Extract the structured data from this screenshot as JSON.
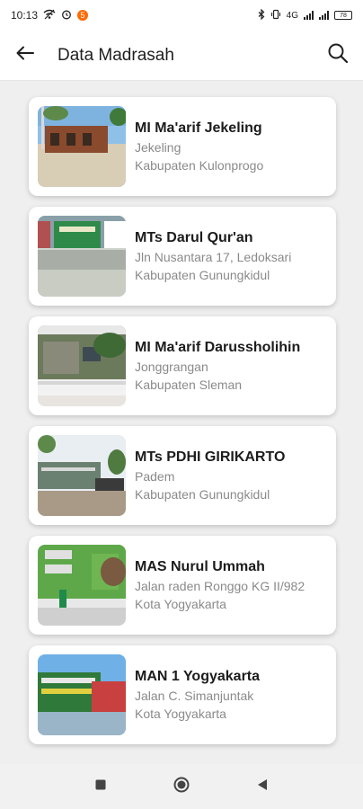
{
  "status": {
    "time": "10:13",
    "notif_badge": "5",
    "net_label": "4G",
    "battery": "78"
  },
  "appbar": {
    "title": "Data Madrasah"
  },
  "items": [
    {
      "name": "MI Ma'arif Jekeling",
      "address": "Jekeling",
      "region": "Kabupaten Kulonprogo"
    },
    {
      "name": "MTs Darul Qur'an",
      "address": "Jln Nusantara 17, Ledoksari",
      "region": "Kabupaten Gunungkidul"
    },
    {
      "name": "MI Ma'arif Darussholihin",
      "address": "Jonggrangan",
      "region": "Kabupaten Sleman"
    },
    {
      "name": "MTs PDHI GIRIKARTO",
      "address": "Padem",
      "region": "Kabupaten Gunungkidul"
    },
    {
      "name": "MAS Nurul Ummah",
      "address": "Jalan raden Ronggo KG II/982",
      "region": "Kota Yogyakarta"
    },
    {
      "name": "MAN 1 Yogyakarta",
      "address": "Jalan C. Simanjuntak",
      "region": "Kota Yogyakarta"
    }
  ]
}
